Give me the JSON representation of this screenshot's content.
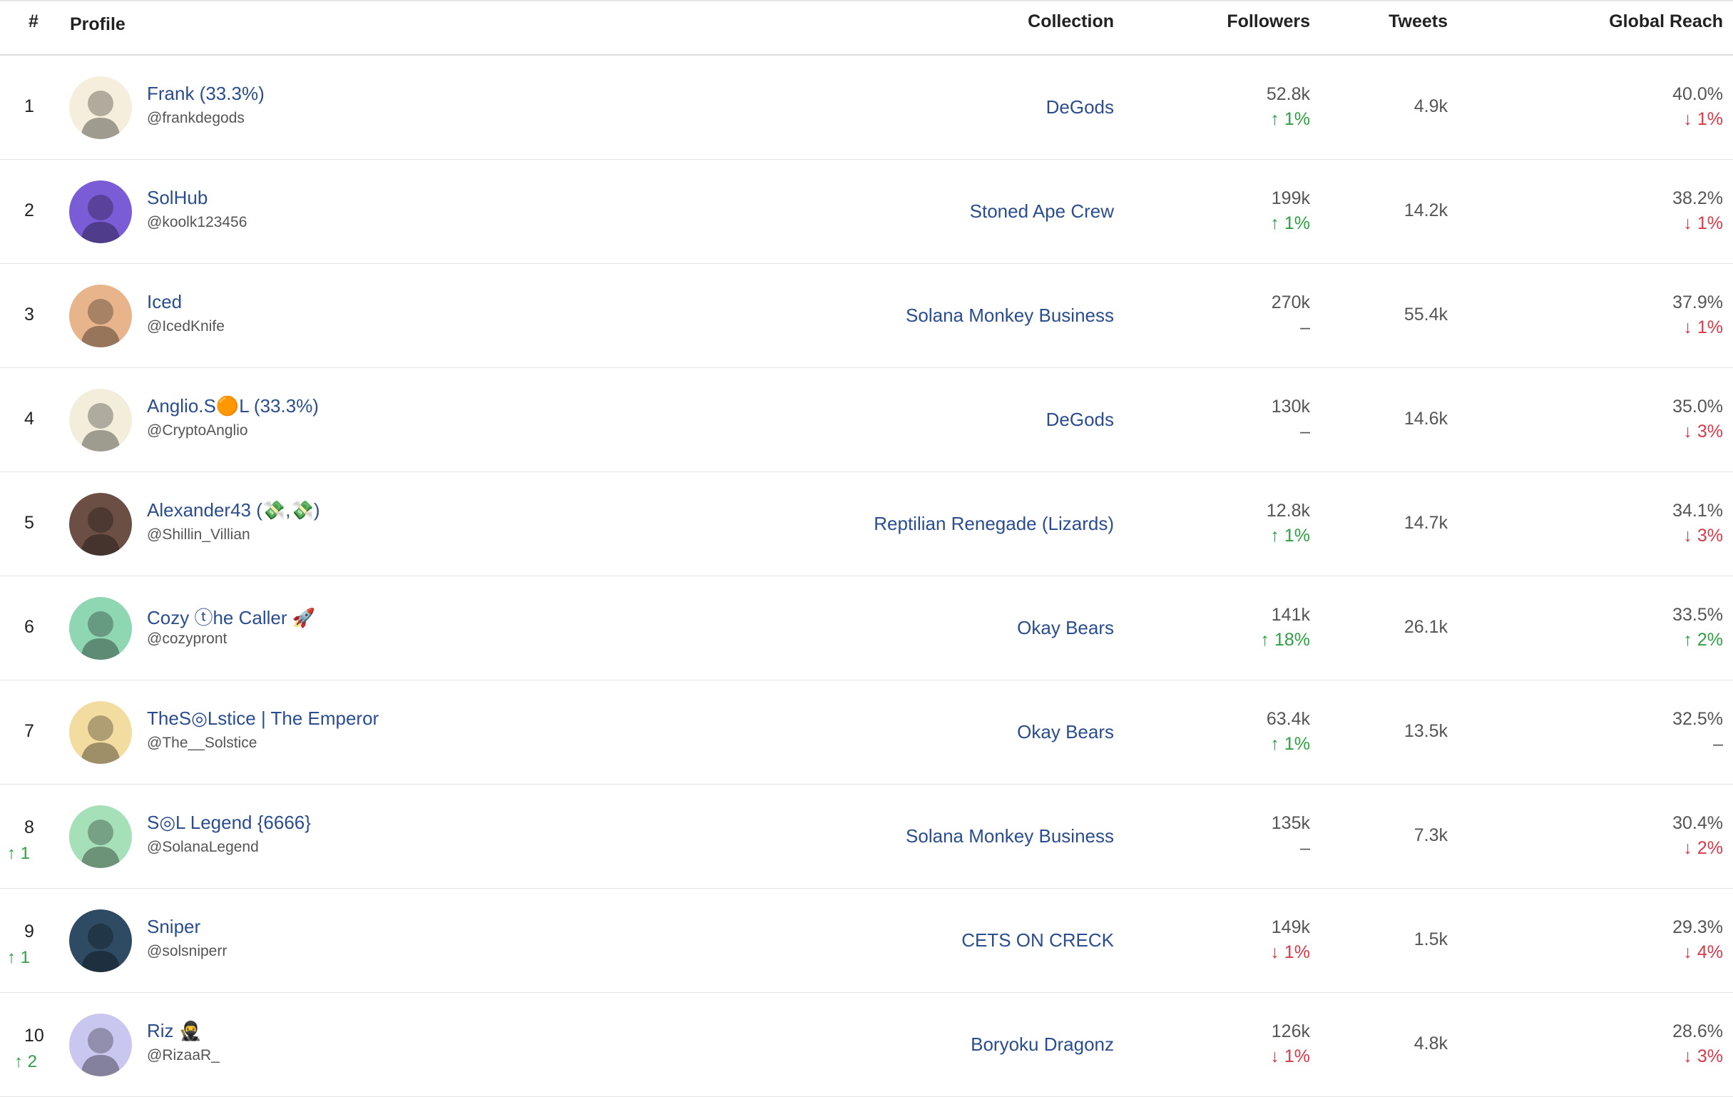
{
  "header": {
    "rank": "#",
    "profile": "Profile",
    "collection": "Collection",
    "followers": "Followers",
    "tweets": "Tweets",
    "global_reach": "Global Reach"
  },
  "colors": {
    "link": "#2a4d8f",
    "up": "#2ea043",
    "down": "#d73a49"
  },
  "rows": [
    {
      "rank": "1",
      "rank_change": "",
      "name": "Frank (33.3%)",
      "handle": "@frankdegods",
      "collection": "DeGods",
      "followers": "52.8k",
      "followers_change": "↑ 1%",
      "followers_dir": "up",
      "tweets": "4.9k",
      "reach": "40.0%",
      "reach_change": "↓ 1%",
      "reach_dir": "down",
      "avatar_bg": "#f5eedc"
    },
    {
      "rank": "2",
      "rank_change": "",
      "name": "SolHub",
      "handle": "@koolk123456",
      "collection": "Stoned Ape Crew",
      "followers": "199k",
      "followers_change": "↑ 1%",
      "followers_dir": "up",
      "tweets": "14.2k",
      "reach": "38.2%",
      "reach_change": "↓ 1%",
      "reach_dir": "down",
      "avatar_bg": "#7a5cd6"
    },
    {
      "rank": "3",
      "rank_change": "",
      "name": "Iced",
      "handle": "@IcedKnife",
      "collection": "Solana Monkey Business",
      "followers": "270k",
      "followers_change": "–",
      "followers_dir": "flat",
      "tweets": "55.4k",
      "reach": "37.9%",
      "reach_change": "↓ 1%",
      "reach_dir": "down",
      "avatar_bg": "#e8b48c"
    },
    {
      "rank": "4",
      "rank_change": "",
      "name": "Anglio.S🟠L (33.3%)",
      "handle": "@CryptoAnglio",
      "collection": "DeGods",
      "followers": "130k",
      "followers_change": "–",
      "followers_dir": "flat",
      "tweets": "14.6k",
      "reach": "35.0%",
      "reach_change": "↓ 3%",
      "reach_dir": "down",
      "avatar_bg": "#f3eedc"
    },
    {
      "rank": "5",
      "rank_change": "",
      "name": "Alexander43 (💸,💸)",
      "handle": "@Shillin_Villian",
      "collection": "Reptilian Renegade (Lizards)",
      "followers": "12.8k",
      "followers_change": "↑ 1%",
      "followers_dir": "up",
      "tweets": "14.7k",
      "reach": "34.1%",
      "reach_change": "↓ 3%",
      "reach_dir": "down",
      "avatar_bg": "#6b4f45"
    },
    {
      "rank": "6",
      "rank_change": "",
      "name": "Cozy ⓣhe Caller 🚀",
      "handle": "@cozypront",
      "collection": "Okay Bears",
      "followers": "141k",
      "followers_change": "↑ 18%",
      "followers_dir": "up",
      "tweets": "26.1k",
      "reach": "33.5%",
      "reach_change": "↑ 2%",
      "reach_dir": "up",
      "avatar_bg": "#8fd6b3"
    },
    {
      "rank": "7",
      "rank_change": "",
      "name": "TheS◎Lstice | The Emperor",
      "handle": "@The__Solstice",
      "collection": "Okay Bears",
      "followers": "63.4k",
      "followers_change": "↑ 1%",
      "followers_dir": "up",
      "tweets": "13.5k",
      "reach": "32.5%",
      "reach_change": "–",
      "reach_dir": "flat",
      "avatar_bg": "#f3dca0"
    },
    {
      "rank": "8",
      "rank_change": "↑ 1",
      "name": "S◎L Legend {6666}",
      "handle": "@SolanaLegend",
      "collection": "Solana Monkey Business",
      "followers": "135k",
      "followers_change": "–",
      "followers_dir": "flat",
      "tweets": "7.3k",
      "reach": "30.4%",
      "reach_change": "↓ 2%",
      "reach_dir": "down",
      "avatar_bg": "#a6e0b8"
    },
    {
      "rank": "9",
      "rank_change": "↑ 1",
      "name": "Sniper",
      "handle": "@solsniperr",
      "collection": "CETS ON CRECK",
      "followers": "149k",
      "followers_change": "↓ 1%",
      "followers_dir": "down",
      "tweets": "1.5k",
      "reach": "29.3%",
      "reach_change": "↓ 4%",
      "reach_dir": "down",
      "avatar_bg": "#2f4b63"
    },
    {
      "rank": "10",
      "rank_change": "↑ 2",
      "name": "Riz 🥷",
      "handle": "@RizaaR_",
      "collection": "Boryoku Dragonz",
      "followers": "126k",
      "followers_change": "↓ 1%",
      "followers_dir": "down",
      "tweets": "4.8k",
      "reach": "28.6%",
      "reach_change": "↓ 3%",
      "reach_dir": "down",
      "avatar_bg": "#c9c6f0"
    }
  ]
}
